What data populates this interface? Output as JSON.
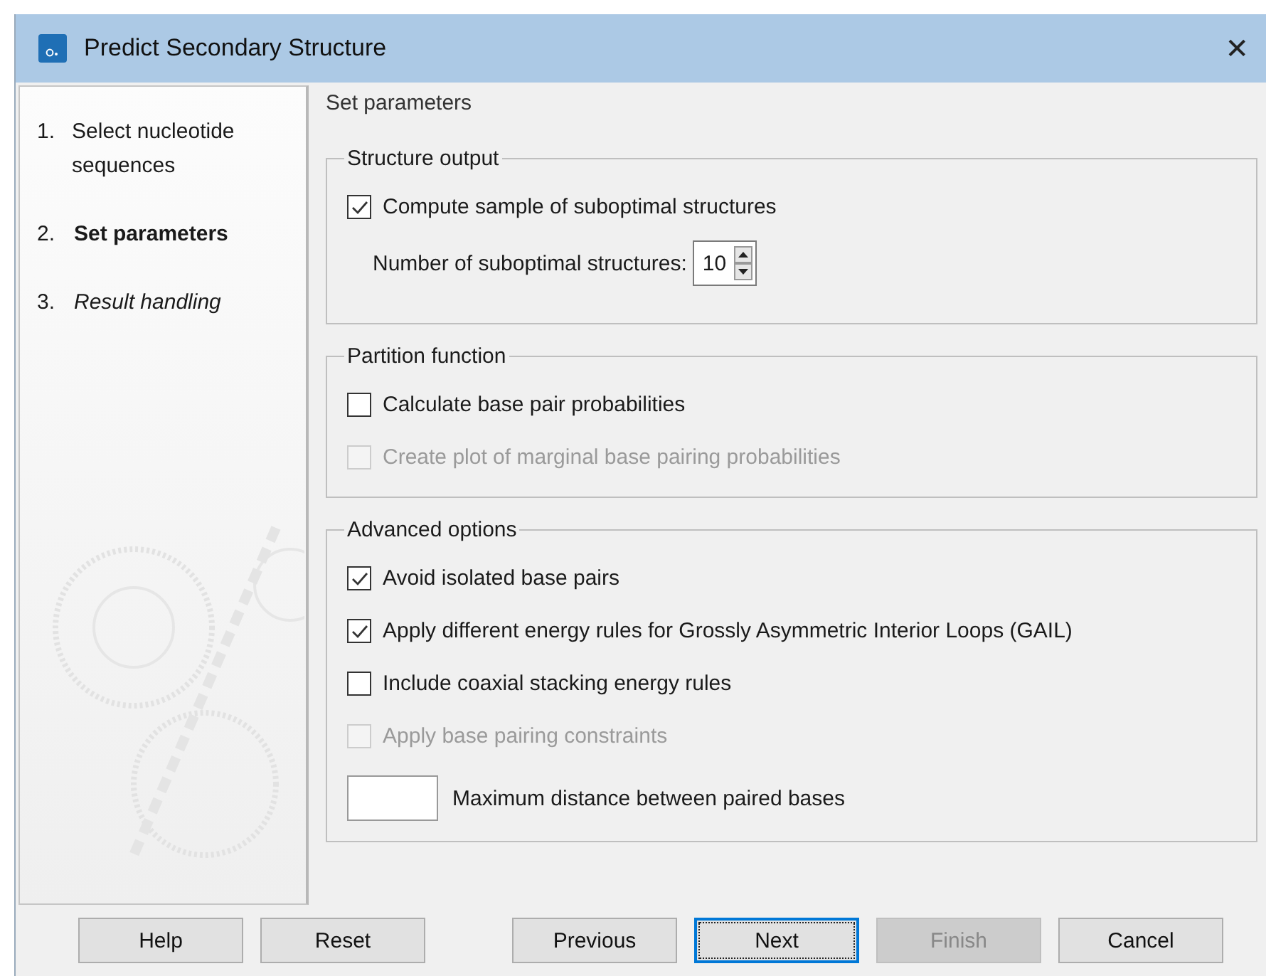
{
  "window": {
    "title": "Predict Secondary Structure",
    "close": "✕"
  },
  "steps": [
    {
      "number": "1.",
      "label": "Select nucleotide sequences",
      "kind": "done"
    },
    {
      "number": "2.",
      "label": "Set parameters",
      "kind": "current"
    },
    {
      "number": "3.",
      "label": "Result handling",
      "kind": "pending"
    }
  ],
  "heading": "Set parameters",
  "groups": [
    {
      "title": "Structure output",
      "items": [
        {
          "kind": "checkbox",
          "label": "Compute sample of suboptimal structures",
          "checked": true,
          "disabled": false
        },
        {
          "kind": "spinner",
          "label": "Number of suboptimal structures:",
          "value": "10"
        }
      ]
    },
    {
      "title": "Partition function",
      "items": [
        {
          "kind": "checkbox",
          "label": "Calculate base pair probabilities",
          "checked": false,
          "disabled": false
        },
        {
          "kind": "checkbox",
          "label": "Create plot of marginal base pairing probabilities",
          "checked": false,
          "disabled": true
        }
      ]
    },
    {
      "title": "Advanced options",
      "items": [
        {
          "kind": "checkbox",
          "label": "Avoid isolated base pairs",
          "checked": true,
          "disabled": false
        },
        {
          "kind": "checkbox",
          "label": "Apply different energy rules for Grossly Asymmetric Interior Loops (GAIL)",
          "checked": true,
          "disabled": false
        },
        {
          "kind": "checkbox",
          "label": "Include coaxial stacking energy rules",
          "checked": false,
          "disabled": false
        },
        {
          "kind": "checkbox",
          "label": "Apply base pairing constraints",
          "checked": false,
          "disabled": true
        },
        {
          "kind": "field",
          "label": "Maximum distance between paired bases"
        }
      ]
    }
  ],
  "buttons_left": [
    {
      "label": "Help",
      "disabled": false,
      "focused": false
    },
    {
      "label": "Reset",
      "disabled": false,
      "focused": false
    }
  ],
  "buttons_right": [
    {
      "label": "Previous",
      "disabled": false,
      "focused": false
    },
    {
      "label": "Next",
      "disabled": false,
      "focused": true
    },
    {
      "label": "Finish",
      "disabled": true,
      "focused": false
    },
    {
      "label": "Cancel",
      "disabled": false,
      "focused": false
    }
  ]
}
